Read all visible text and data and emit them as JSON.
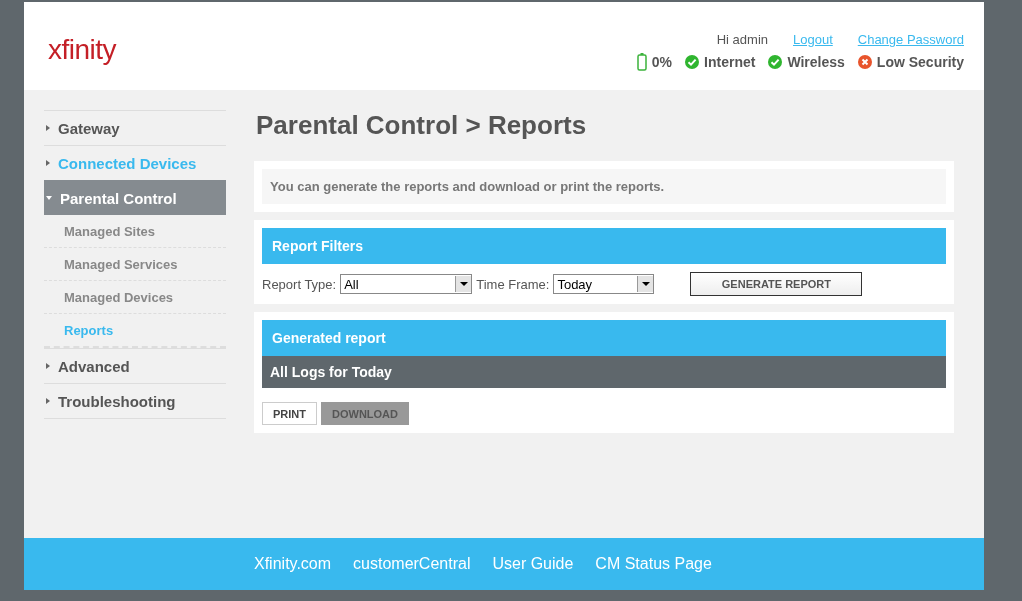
{
  "header": {
    "logo": "xfinity",
    "greeting": "Hi admin",
    "links": [
      "Logout",
      "Change Password"
    ],
    "status": [
      {
        "kind": "battery",
        "label": "0%"
      },
      {
        "kind": "ok",
        "label": "Internet"
      },
      {
        "kind": "ok",
        "label": "Wireless"
      },
      {
        "kind": "error",
        "label": "Low Security"
      }
    ]
  },
  "sidebar": {
    "items": [
      {
        "label": "Gateway",
        "selected": false,
        "expanded": false,
        "highlighted": false
      },
      {
        "label": "Connected Devices",
        "selected": false,
        "expanded": false,
        "highlighted": true
      },
      {
        "label": "Parental Control",
        "selected": true,
        "expanded": true,
        "highlighted": false,
        "children": [
          {
            "label": "Managed Sites",
            "selected": false
          },
          {
            "label": "Managed Services",
            "selected": false
          },
          {
            "label": "Managed Devices",
            "selected": false
          },
          {
            "label": "Reports",
            "selected": true
          }
        ]
      },
      {
        "label": "Advanced",
        "selected": false,
        "expanded": false,
        "highlighted": false
      },
      {
        "label": "Troubleshooting",
        "selected": false,
        "expanded": false,
        "highlighted": false
      }
    ]
  },
  "page_title": "Parental Control > Reports",
  "intro": "You can generate the reports and download or print the reports.",
  "filters": {
    "title": "Report Filters",
    "report_type": {
      "label": "Report Type:",
      "value": "All"
    },
    "time_frame": {
      "label": "Time Frame:",
      "value": "Today"
    },
    "button": "GENERATE REPORT"
  },
  "report": {
    "title": "Generated report",
    "subtitle": "All Logs for Today",
    "buttons": [
      {
        "label": "PRINT",
        "disabled": false
      },
      {
        "label": "DOWNLOAD",
        "disabled": true
      }
    ]
  },
  "footer": {
    "links": [
      "Xfinity.com",
      "customerCentral",
      "User Guide",
      "CM Status Page"
    ]
  }
}
